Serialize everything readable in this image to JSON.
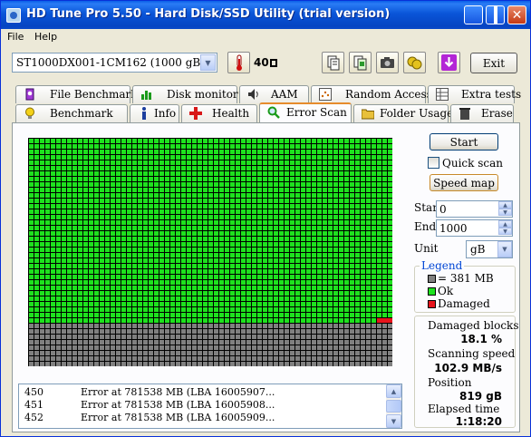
{
  "window": {
    "title": "HD Tune Pro 5.50 - Hard Disk/SSD Utility (trial version)"
  },
  "menu": {
    "file": "File",
    "help": "Help"
  },
  "toolbar": {
    "drive": "ST1000DX001-1CM162 (1000 gB)",
    "temperature": "40",
    "exit_label": "Exit",
    "tool_icons": [
      "copy-text-icon",
      "copy-screenshot-icon",
      "camera-icon",
      "health-report-icon",
      "save-icon"
    ]
  },
  "tabs": {
    "top_row": [
      "File Benchmark",
      "Disk monitor",
      "AAM",
      "Random Access",
      "Extra tests"
    ],
    "bottom_row": [
      "Benchmark",
      "Info",
      "Health",
      "Error Scan",
      "Folder Usage",
      "Erase"
    ],
    "active": "Error Scan"
  },
  "scan_map": {
    "progress_fraction": 0.819,
    "colors": {
      "ok": "#1ee21e",
      "unscanned": "#808080",
      "damaged": "#e8141c"
    }
  },
  "log": {
    "rows": [
      {
        "num": "450",
        "msg": "Error at 781538 MB (LBA 16005907..."
      },
      {
        "num": "451",
        "msg": "Error at 781538 MB (LBA 16005908..."
      },
      {
        "num": "452",
        "msg": "Error at 781538 MB (LBA 16005909..."
      }
    ]
  },
  "controls": {
    "start_button": "Start",
    "quick_scan_label": "Quick scan",
    "quick_scan_checked": false,
    "speed_map_button": "Speed map",
    "start_label": "Start",
    "start_value": "0",
    "end_label": "End",
    "end_value": "1000",
    "unit_label": "Unit",
    "unit_value": "gB"
  },
  "legend": {
    "title": "Legend",
    "block_size": "= 381 MB",
    "ok": "Ok",
    "damaged": "Damaged"
  },
  "stats": {
    "damaged_blocks_label": "Damaged blocks",
    "damaged_blocks_value": "18.1 %",
    "scanning_speed_label": "Scanning speed",
    "scanning_speed_value": "102.9 MB/s",
    "position_label": "Position",
    "position_value": "819 gB",
    "elapsed_label": "Elapsed time",
    "elapsed_value": "1:18:20"
  }
}
